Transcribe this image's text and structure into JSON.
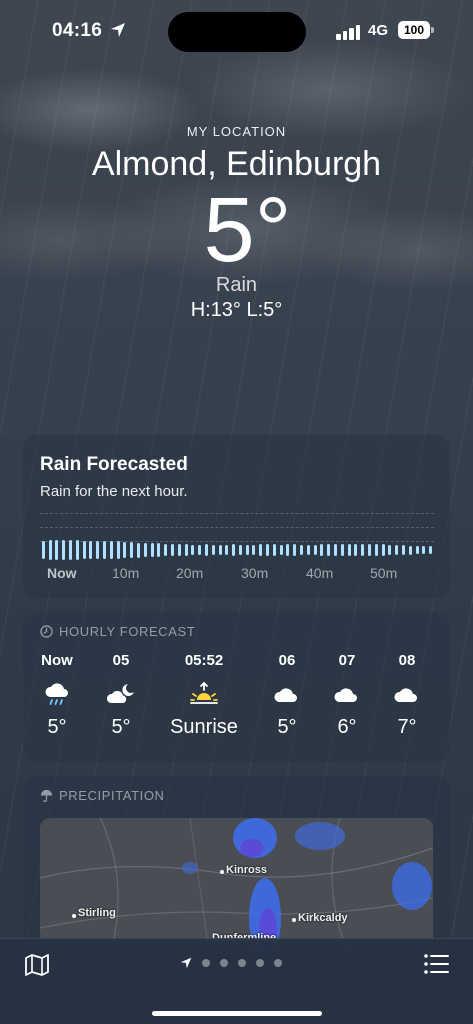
{
  "status": {
    "time": "04:16",
    "network": "4G",
    "battery": "100"
  },
  "header": {
    "label": "MY LOCATION",
    "city": "Almond, Edinburgh",
    "temp": "5°",
    "condition": "Rain",
    "hilo": "H:13°  L:5°"
  },
  "rain_card": {
    "title": "Rain Forecasted",
    "subtitle": "Rain for the next hour.",
    "times": [
      "Now",
      "10m",
      "20m",
      "30m",
      "40m",
      "50m"
    ],
    "intensity": [
      0.62,
      0.64,
      0.65,
      0.64,
      0.65,
      0.64,
      0.63,
      0.62,
      0.63,
      0.62,
      0.6,
      0.58,
      0.55,
      0.52,
      0.5,
      0.48,
      0.46,
      0.44,
      0.42,
      0.4,
      0.38,
      0.37,
      0.36,
      0.36,
      0.37,
      0.36,
      0.35,
      0.36,
      0.37,
      0.36,
      0.35,
      0.36,
      0.37,
      0.38,
      0.37,
      0.36,
      0.38,
      0.37,
      0.36,
      0.35,
      0.36,
      0.38,
      0.4,
      0.42,
      0.42,
      0.41,
      0.42,
      0.43,
      0.42,
      0.4,
      0.38,
      0.36,
      0.34,
      0.32,
      0.3,
      0.28,
      0.26,
      0.25
    ]
  },
  "hourly": {
    "heading": "HOURLY FORECAST",
    "items": [
      {
        "time": "Now",
        "icon": "rain-cloud-icon",
        "value": "5°"
      },
      {
        "time": "05",
        "icon": "moon-cloud-icon",
        "value": "5°"
      },
      {
        "time": "05:52",
        "icon": "sunrise-icon",
        "value": "Sunrise"
      },
      {
        "time": "06",
        "icon": "cloud-icon",
        "value": "5°"
      },
      {
        "time": "07",
        "icon": "cloud-icon",
        "value": "6°"
      },
      {
        "time": "08",
        "icon": "cloud-icon",
        "value": "7°"
      }
    ]
  },
  "precipitation": {
    "heading": "PRECIPITATION",
    "places": [
      "Kinross",
      "Stirling",
      "Kirkcaldy",
      "Dunfermline"
    ]
  },
  "colors": {
    "rain_bar": "#aee0ff",
    "radar": "#3d6ef0"
  }
}
